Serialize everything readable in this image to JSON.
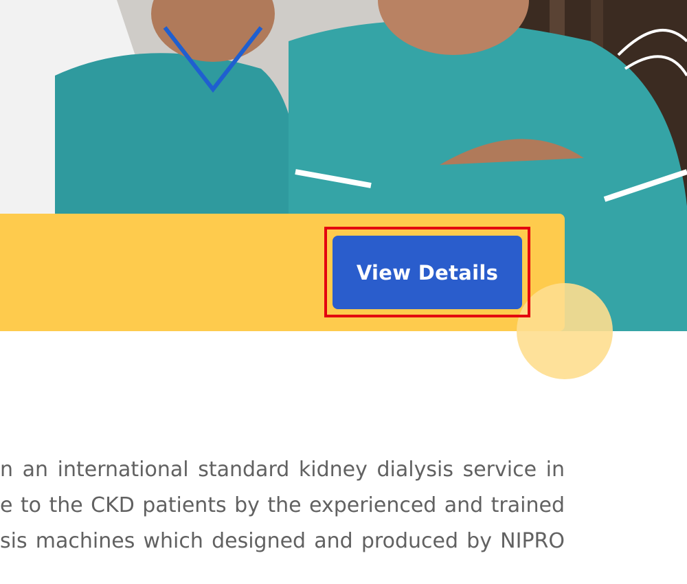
{
  "hero": {
    "image_alt": "Dialysis nurses in teal uniforms",
    "view_details_label": "View Details"
  },
  "content": {
    "lines": [
      "n an international standard kidney dialysis service in",
      "e to the CKD patients by the experienced and trained",
      "sis machines which designed and produced by NIPRO"
    ]
  },
  "colors": {
    "banner": "#fecb4d",
    "button": "#2a5dcc",
    "highlight": "#e3000f",
    "uniform": "#2f9a9e",
    "text": "#616161"
  }
}
